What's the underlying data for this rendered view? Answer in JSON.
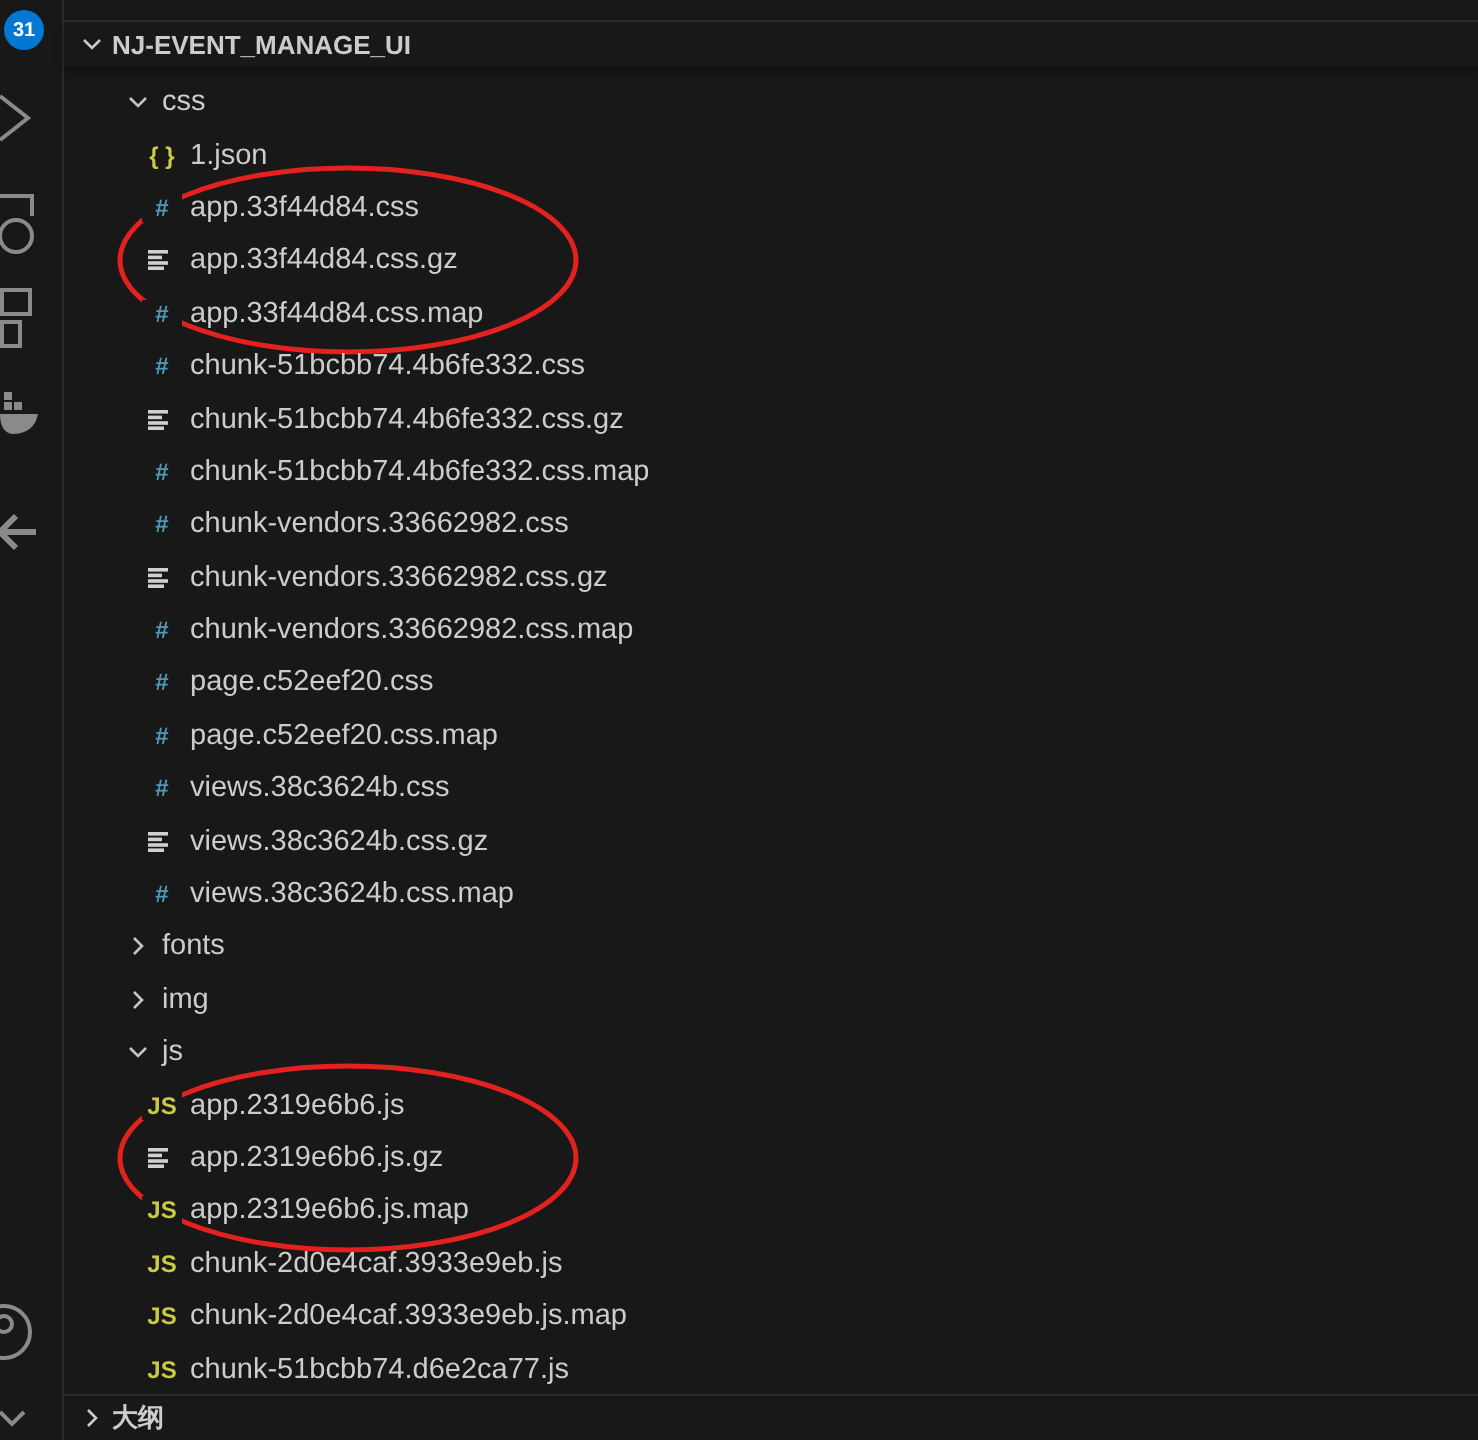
{
  "activity_bar": {
    "badge": "31"
  },
  "explorer": {
    "title": "NJ-EVENT_MANAGE_UI",
    "expanded": true,
    "children": [
      {
        "name": "css",
        "kind": "folder",
        "expanded": true,
        "children": [
          {
            "name": "1.json",
            "kind": "json",
            "icon": "{ }"
          },
          {
            "name": "app.33f44d84.css",
            "kind": "css",
            "icon": "#"
          },
          {
            "name": "app.33f44d84.css.gz",
            "kind": "gz",
            "circled": true
          },
          {
            "name": "app.33f44d84.css.map",
            "kind": "css",
            "icon": "#"
          },
          {
            "name": "chunk-51bcbb74.4b6fe332.css",
            "kind": "css",
            "icon": "#"
          },
          {
            "name": "chunk-51bcbb74.4b6fe332.css.gz",
            "kind": "gz"
          },
          {
            "name": "chunk-51bcbb74.4b6fe332.css.map",
            "kind": "css",
            "icon": "#"
          },
          {
            "name": "chunk-vendors.33662982.css",
            "kind": "css",
            "icon": "#"
          },
          {
            "name": "chunk-vendors.33662982.css.gz",
            "kind": "gz"
          },
          {
            "name": "chunk-vendors.33662982.css.map",
            "kind": "css",
            "icon": "#"
          },
          {
            "name": "page.c52eef20.css",
            "kind": "css",
            "icon": "#"
          },
          {
            "name": "page.c52eef20.css.map",
            "kind": "css",
            "icon": "#"
          },
          {
            "name": "views.38c3624b.css",
            "kind": "css",
            "icon": "#"
          },
          {
            "name": "views.38c3624b.css.gz",
            "kind": "gz"
          },
          {
            "name": "views.38c3624b.css.map",
            "kind": "css",
            "icon": "#"
          }
        ]
      },
      {
        "name": "fonts",
        "kind": "folder",
        "expanded": false
      },
      {
        "name": "img",
        "kind": "folder",
        "expanded": false
      },
      {
        "name": "js",
        "kind": "folder",
        "expanded": true,
        "children": [
          {
            "name": "app.2319e6b6.js",
            "kind": "js",
            "icon": "JS"
          },
          {
            "name": "app.2319e6b6.js.gz",
            "kind": "gz",
            "circled": true
          },
          {
            "name": "app.2319e6b6.js.map",
            "kind": "js",
            "icon": "JS"
          },
          {
            "name": "chunk-2d0e4caf.3933e9eb.js",
            "kind": "js",
            "icon": "JS"
          },
          {
            "name": "chunk-2d0e4caf.3933e9eb.js.map",
            "kind": "js",
            "icon": "JS"
          },
          {
            "name": "chunk-51bcbb74.d6e2ca77.js",
            "kind": "js",
            "icon": "JS"
          }
        ]
      }
    ]
  },
  "outline": {
    "title": "大纲",
    "expanded": false
  }
}
